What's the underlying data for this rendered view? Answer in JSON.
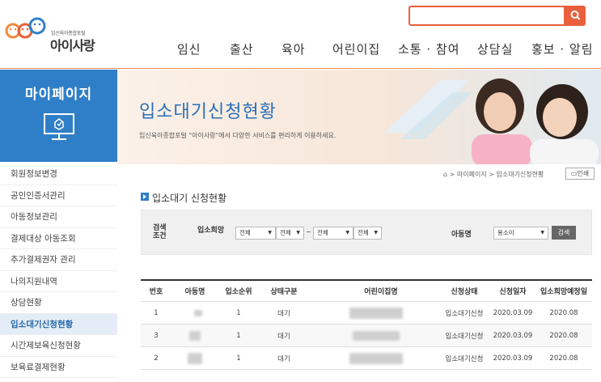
{
  "header": {
    "logo_small": "임신육아종합포털",
    "logo_main": "아이사랑",
    "search_placeholder": "",
    "nav": [
      "임신",
      "출산",
      "육아",
      "어린이집",
      "소통 · 참여",
      "상담실",
      "홍보 · 알림"
    ]
  },
  "sidebar": {
    "title": "마이페이지",
    "items": [
      {
        "label": "회원정보변경"
      },
      {
        "label": "공인인증서관리"
      },
      {
        "label": "아동정보관리"
      },
      {
        "label": "결제대상 아동조회"
      },
      {
        "label": "추가결제권자 관리"
      },
      {
        "label": "나의지원내역"
      },
      {
        "label": "상담현황"
      },
      {
        "label": "입소대기신청현황"
      },
      {
        "label": "시간제보육신청현황"
      },
      {
        "label": "보육료결제현황"
      }
    ],
    "active_index": 7
  },
  "banner": {
    "title": "입소대기신청현황",
    "subtitle": "임신육아종합포털 \"아이사랑\"에서 다양한 서비스를 편리하게 이용하세요."
  },
  "breadcrumb": {
    "home": "⌂",
    "items": [
      "마이페이지",
      "입소대기신청현황"
    ],
    "sep": ">",
    "print": "인쇄"
  },
  "section_title": "입소대기 신청현황",
  "filter": {
    "label1": "검색조건",
    "label2": "입소희망",
    "selects": [
      "전체",
      "전체",
      "전체",
      "전체"
    ],
    "tilde": "~",
    "child_label": "아동명",
    "child_select": "용소이",
    "search_button": "검색"
  },
  "table": {
    "headers": [
      "번호",
      "아동명",
      "입소순위",
      "상태구분",
      "어린이집명",
      "신청상태",
      "신청일자",
      "입소희망예정일"
    ],
    "rows": [
      {
        "no": "1",
        "rank": "1",
        "status": "대기",
        "apply_status": "입소대기신청",
        "date": "2020.03.09",
        "hope": "2020.08"
      },
      {
        "no": "3",
        "rank": "1",
        "status": "대기",
        "apply_status": "입소대기신청",
        "date": "2020.03.09",
        "hope": "2020.08"
      },
      {
        "no": "2",
        "rank": "1",
        "status": "대기",
        "apply_status": "입소대기신청",
        "date": "2020.03.09",
        "hope": "2020.08"
      }
    ]
  },
  "colors": {
    "accent_orange": "#e8603c",
    "sidebar_blue": "#2f7fc8",
    "title_blue": "#2a6fb5"
  }
}
